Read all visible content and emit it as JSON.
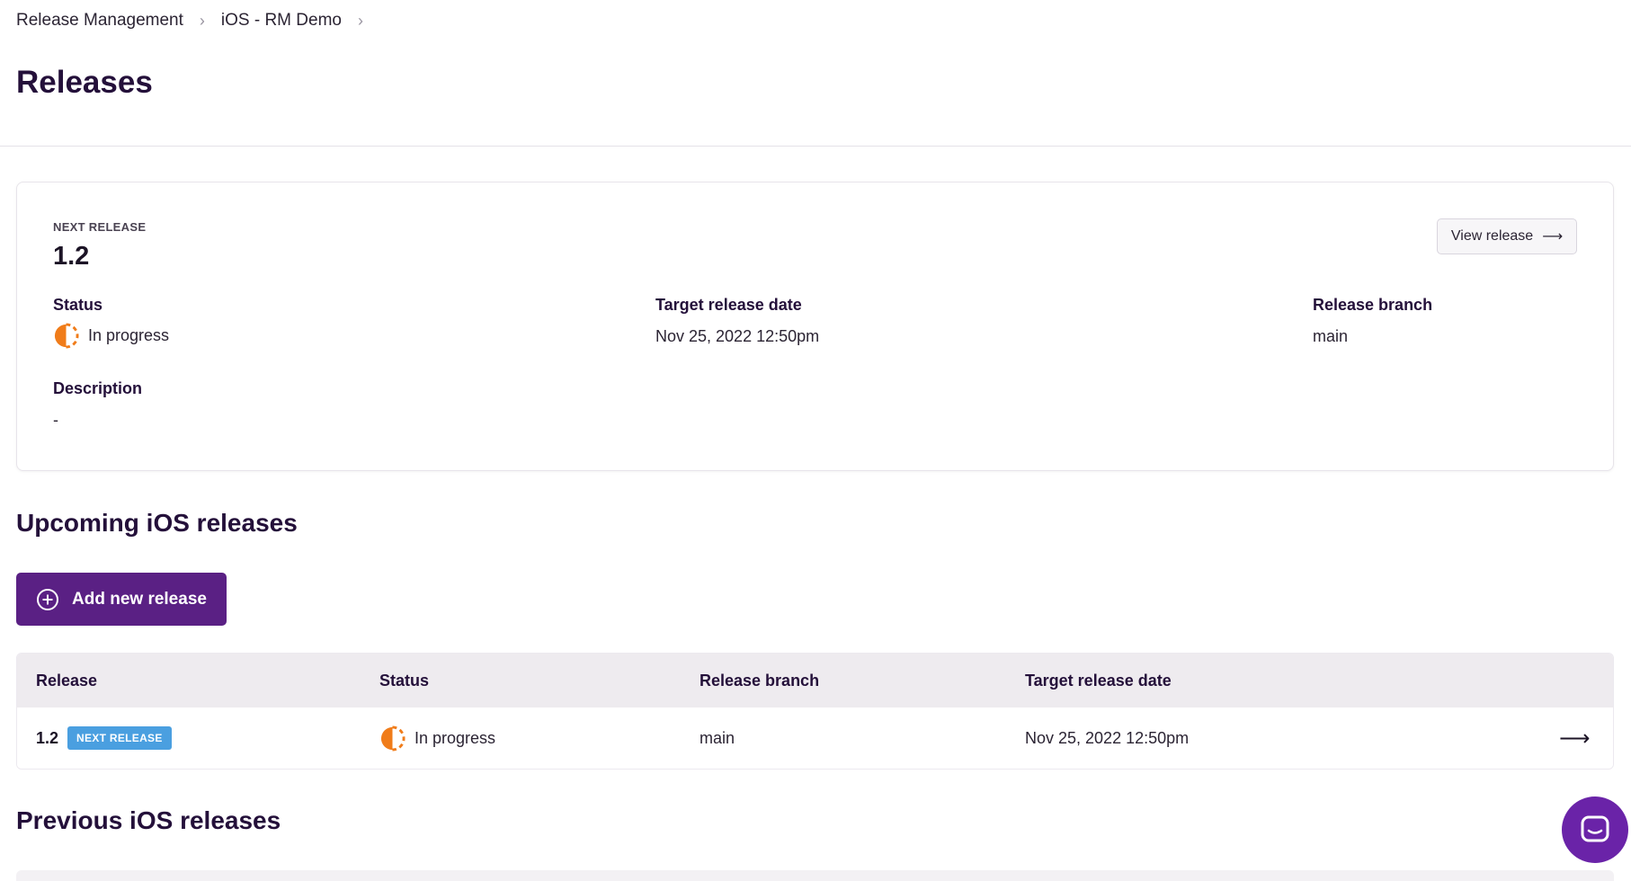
{
  "breadcrumb": {
    "items": [
      "Release Management",
      "iOS - RM Demo"
    ],
    "separator": "›"
  },
  "page": {
    "title": "Releases"
  },
  "next_release": {
    "eyebrow": "NEXT RELEASE",
    "version": "1.2",
    "view_button": "View release",
    "view_arrow": "⟶",
    "status_label": "Status",
    "status_value": "In progress",
    "target_label": "Target release date",
    "target_value": "Nov 25, 2022 12:50pm",
    "branch_label": "Release branch",
    "branch_value": "main",
    "description_label": "Description",
    "description_value": "-"
  },
  "upcoming": {
    "title": "Upcoming iOS releases",
    "add_button": "Add new release",
    "columns": [
      "Release",
      "Status",
      "Release branch",
      "Target release date"
    ],
    "rows": [
      {
        "release": "1.2",
        "badge": "NEXT RELEASE",
        "status": "In progress",
        "branch": "main",
        "target": "Nov 25, 2022 12:50pm",
        "arrow": "⟶"
      }
    ]
  },
  "previous": {
    "title": "Previous iOS releases"
  },
  "colors": {
    "accent": "#5a2084",
    "status_in_progress": "#f07c1a",
    "badge": "#4a9fe0",
    "chat": "#6a23a8"
  }
}
